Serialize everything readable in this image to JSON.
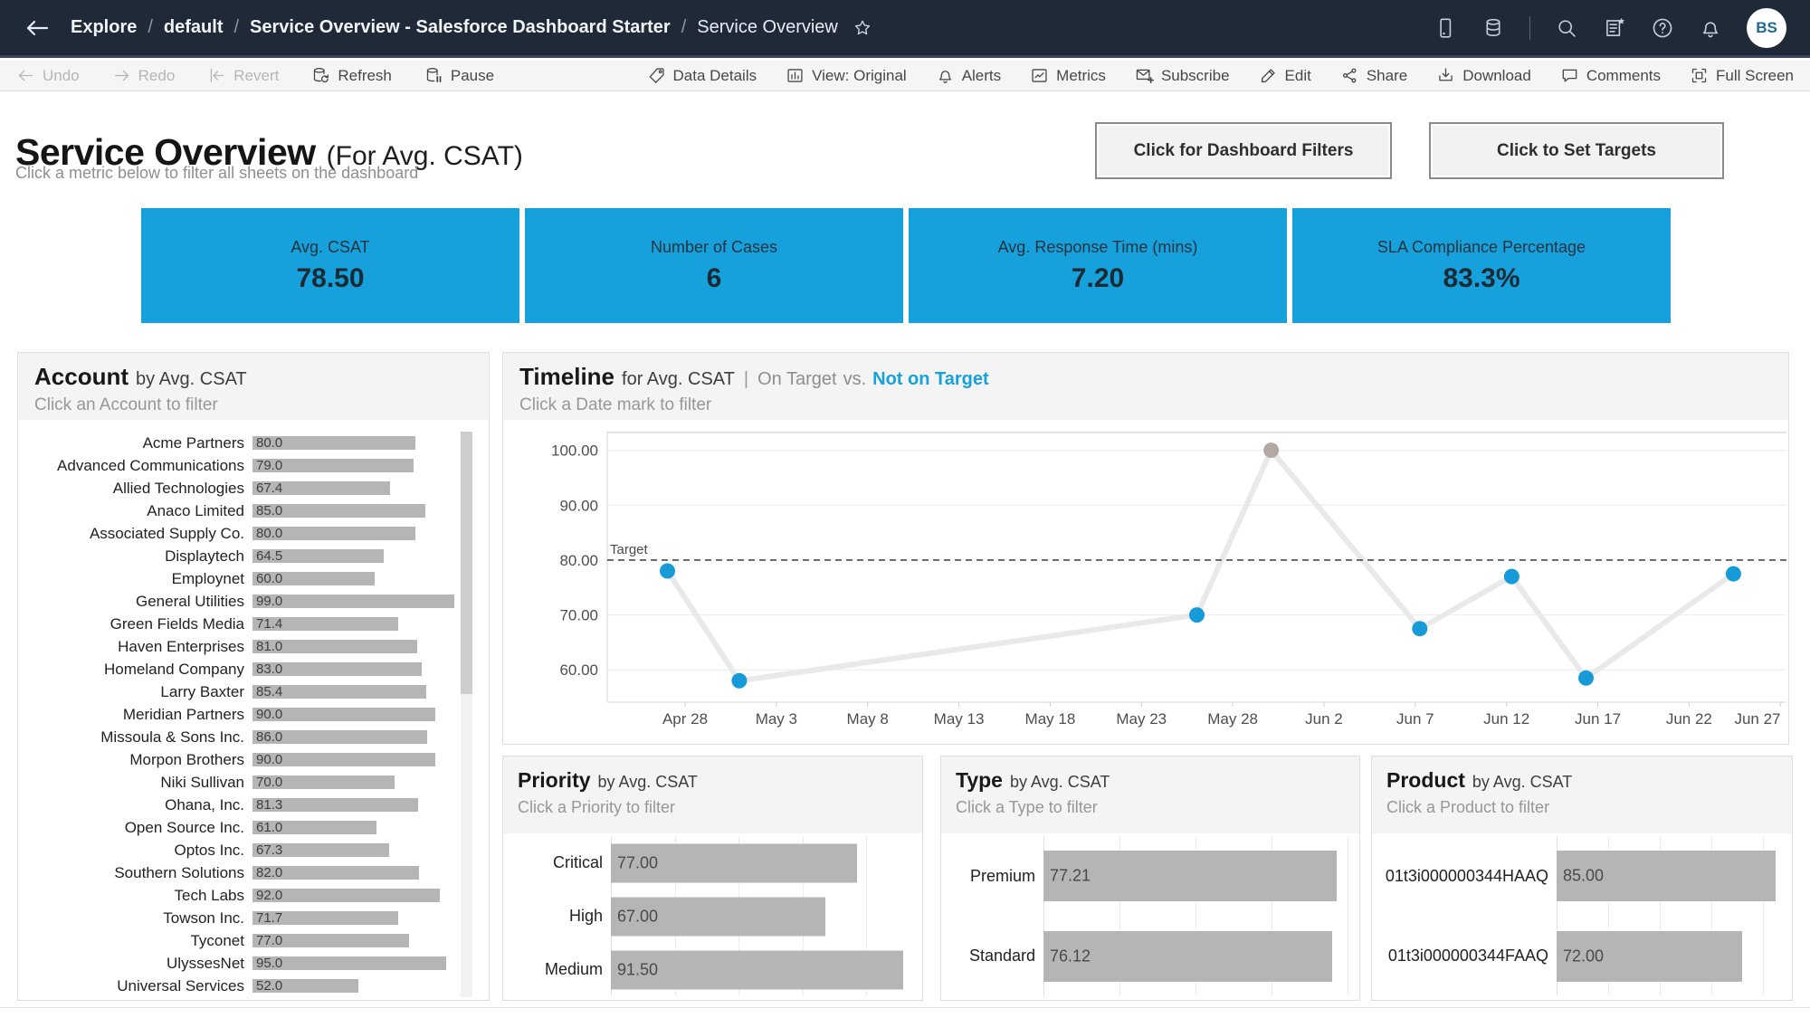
{
  "colors": {
    "topbar_bg": "#1f2938",
    "topbar_text": "#f2f5f8",
    "toolbar_bg": "#f5f5f5",
    "toolbar_text": "#474747",
    "toolbar_disabled": "#b6b6b6",
    "accent_blue": "#16a0dc",
    "bar_gray": "#b5b5b5",
    "line_gray": "#e9e9e9",
    "point_blue": "#169bd8",
    "point_gray": "#b3a9a2",
    "panel_border": "#dedede",
    "band_bg": "#f4f4f4"
  },
  "topbar": {
    "back_icon": "back-arrow-icon",
    "separator": "/",
    "breadcrumb": [
      {
        "label": "Explore",
        "bold": true,
        "current": false
      },
      {
        "label": "default",
        "bold": true,
        "current": false
      },
      {
        "label": "Service Overview - Salesforce Dashboard Starter",
        "bold": true,
        "current": false
      },
      {
        "label": "Service Overview",
        "bold": false,
        "current": true
      }
    ],
    "favorite_icon": "star-icon",
    "right_icons": [
      "device-preview-icon",
      "data-source-icon",
      "divider",
      "search-icon",
      "new-workbook-icon",
      "help-icon",
      "notifications-icon"
    ],
    "avatar": "BS"
  },
  "toolbar": {
    "left": [
      {
        "label": "Undo",
        "icon": "undo-icon",
        "disabled": true
      },
      {
        "label": "Redo",
        "icon": "redo-icon",
        "disabled": true
      },
      {
        "label": "Revert",
        "icon": "revert-icon",
        "disabled": true
      },
      {
        "label": "Refresh",
        "icon": "refresh-icon",
        "disabled": false
      },
      {
        "label": "Pause",
        "icon": "pause-icon",
        "disabled": false
      }
    ],
    "right": [
      {
        "label": "Data Details",
        "icon": "tag-icon",
        "disabled": false
      },
      {
        "label": "View: Original",
        "icon": "view-icon",
        "disabled": false
      },
      {
        "label": "Alerts",
        "icon": "alert-bell-icon",
        "disabled": false
      },
      {
        "label": "Metrics",
        "icon": "metrics-icon",
        "disabled": false
      },
      {
        "label": "Subscribe",
        "icon": "subscribe-icon",
        "disabled": false
      },
      {
        "label": "Edit",
        "icon": "edit-icon",
        "disabled": false
      },
      {
        "label": "Share",
        "icon": "share-icon",
        "disabled": false
      },
      {
        "label": "Download",
        "icon": "download-icon",
        "disabled": false
      },
      {
        "label": "Comments",
        "icon": "comments-icon",
        "disabled": false
      },
      {
        "label": "Full Screen",
        "icon": "fullscreen-icon",
        "disabled": false
      }
    ]
  },
  "header": {
    "title": "Service Overview",
    "title_suffix": "(For Avg. CSAT)",
    "subtitle": "Click a metric below to filter all sheets on the dashboard",
    "filters_button": "Click for Dashboard Filters",
    "targets_button": "Click to Set Targets"
  },
  "kpis": [
    {
      "label": "Avg. CSAT",
      "value": "78.50"
    },
    {
      "label": "Number of Cases",
      "value": "6"
    },
    {
      "label": "Avg. Response Time (mins)",
      "value": "7.20"
    },
    {
      "label": "SLA Compliance Percentage",
      "value": "83.3%"
    }
  ],
  "account_panel": {
    "title": "Account",
    "suffix": "by Avg. CSAT",
    "hint": "Click an Account to filter",
    "xmax": 101,
    "rows": [
      {
        "name": "Acme Partners",
        "value": 80.0,
        "display": "80.0"
      },
      {
        "name": "Advanced Communications",
        "value": 79.0,
        "display": "79.0"
      },
      {
        "name": "Allied Technologies",
        "value": 67.4,
        "display": "67.4"
      },
      {
        "name": "Anaco Limited",
        "value": 85.0,
        "display": "85.0"
      },
      {
        "name": "Associated Supply Co.",
        "value": 80.0,
        "display": "80.0"
      },
      {
        "name": "Displaytech",
        "value": 64.5,
        "display": "64.5"
      },
      {
        "name": "Employnet",
        "value": 60.0,
        "display": "60.0"
      },
      {
        "name": "General Utilities",
        "value": 99.0,
        "display": "99.0"
      },
      {
        "name": "Green Fields Media",
        "value": 71.4,
        "display": "71.4"
      },
      {
        "name": "Haven Enterprises",
        "value": 81.0,
        "display": "81.0"
      },
      {
        "name": "Homeland Company",
        "value": 83.0,
        "display": "83.0"
      },
      {
        "name": "Larry Baxter",
        "value": 85.4,
        "display": "85.4"
      },
      {
        "name": "Meridian Partners",
        "value": 90.0,
        "display": "90.0"
      },
      {
        "name": "Missoula & Sons Inc.",
        "value": 86.0,
        "display": "86.0"
      },
      {
        "name": "Morpon Brothers",
        "value": 90.0,
        "display": "90.0"
      },
      {
        "name": "Niki Sullivan",
        "value": 70.0,
        "display": "70.0"
      },
      {
        "name": "Ohana, Inc.",
        "value": 81.3,
        "display": "81.3"
      },
      {
        "name": "Open Source Inc.",
        "value": 61.0,
        "display": "61.0"
      },
      {
        "name": "Optos Inc.",
        "value": 67.3,
        "display": "67.3"
      },
      {
        "name": "Southern Solutions",
        "value": 82.0,
        "display": "82.0"
      },
      {
        "name": "Tech Labs",
        "value": 92.0,
        "display": "92.0"
      },
      {
        "name": "Towson Inc.",
        "value": 71.7,
        "display": "71.7"
      },
      {
        "name": "Tyconet",
        "value": 77.0,
        "display": "77.0"
      },
      {
        "name": "UlyssesNet",
        "value": 95.0,
        "display": "95.0"
      },
      {
        "name": "Universal Services",
        "value": 52.0,
        "display": "52.0"
      }
    ]
  },
  "timeline_panel": {
    "title": "Timeline",
    "suffix": "for Avg. CSAT",
    "divider": "|",
    "legend_gray": "On Target",
    "legend_vs": "vs.",
    "legend_blue": "Not on Target",
    "hint": "Click a Date mark to filter",
    "target_label": "Target",
    "target_value": 80,
    "ylim": [
      54.1,
      103.4
    ],
    "y_ticks": [
      {
        "v": 100,
        "label": "100.00"
      },
      {
        "v": 90,
        "label": "90.00"
      },
      {
        "v": 80,
        "label": "80.00"
      },
      {
        "v": 70,
        "label": "70.00"
      },
      {
        "v": 60,
        "label": "60.00"
      }
    ],
    "x_ticks": [
      "Apr 28",
      "May 3",
      "May 8",
      "May 13",
      "May 18",
      "May 23",
      "May 28",
      "Jun 2",
      "Jun 7",
      "Jun 12",
      "Jun 17",
      "Jun 22",
      "Jun 27"
    ],
    "x_first_frac": 0.066,
    "x_step_frac": 0.0774,
    "points": [
      {
        "date": "Apr 27",
        "value": 78,
        "x_frac": 0.051,
        "on_target": false
      },
      {
        "date": "May 1",
        "value": 58,
        "x_frac": 0.112,
        "on_target": false
      },
      {
        "date": "May 26",
        "value": 70,
        "x_frac": 0.5,
        "on_target": false
      },
      {
        "date": "May 30",
        "value": 100,
        "x_frac": 0.563,
        "on_target": true
      },
      {
        "date": "Jun 7",
        "value": 67.5,
        "x_frac": 0.689,
        "on_target": false
      },
      {
        "date": "Jun 12",
        "value": 77,
        "x_frac": 0.767,
        "on_target": false
      },
      {
        "date": "Jun 16",
        "value": 58.5,
        "x_frac": 0.83,
        "on_target": false
      },
      {
        "date": "Jun 24",
        "value": 77.5,
        "x_frac": 0.955,
        "on_target": false
      }
    ]
  },
  "bar_panels": [
    {
      "key": "priority",
      "title": "Priority",
      "suffix": "by Avg. CSAT",
      "hint": "Click a Priority to filter",
      "xmax": 95.2,
      "grid_values": [
        20,
        40,
        60,
        80
      ],
      "rows": [
        {
          "name": "Critical",
          "value": 77,
          "display": "77.00"
        },
        {
          "name": "High",
          "value": 67,
          "display": "67.00"
        },
        {
          "name": "Medium",
          "value": 91.5,
          "display": "91.50"
        }
      ]
    },
    {
      "key": "type",
      "title": "Type",
      "suffix": "by Avg. CSAT",
      "hint": "Click a Type to filter",
      "xmax": 80.8,
      "grid_values": [
        20,
        40,
        60,
        80
      ],
      "rows": [
        {
          "name": "Premium",
          "value": 77.21,
          "display": "77.21"
        },
        {
          "name": "Standard",
          "value": 76.12,
          "display": "76.12"
        }
      ]
    },
    {
      "key": "product",
      "title": "Product",
      "suffix": "by Avg. CSAT",
      "hint": "Click a Product to filter",
      "xmax": 87.7,
      "grid_values": [
        20,
        40,
        60,
        80
      ],
      "rows": [
        {
          "name": "01t3i000000344HAAQ",
          "value": 85,
          "display": "85.00"
        },
        {
          "name": "01t3i000000344FAAQ",
          "value": 72,
          "display": "72.00"
        }
      ]
    }
  ]
}
